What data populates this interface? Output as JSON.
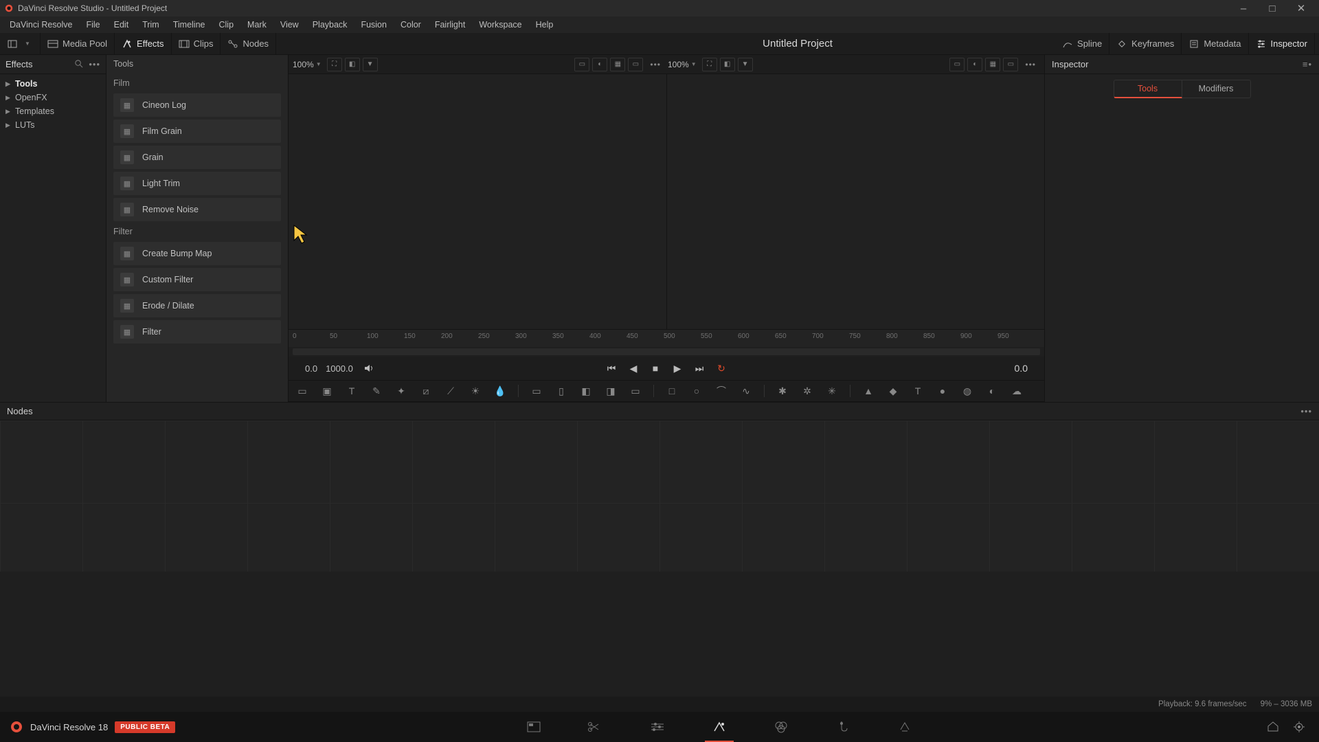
{
  "titlebar": {
    "title": "DaVinci Resolve Studio - Untitled Project"
  },
  "menubar": [
    "DaVinci Resolve",
    "File",
    "Edit",
    "Trim",
    "Timeline",
    "Clip",
    "Mark",
    "View",
    "Playback",
    "Fusion",
    "Color",
    "Fairlight",
    "Workspace",
    "Help"
  ],
  "toolbar": {
    "media_pool": "Media Pool",
    "effects": "Effects",
    "clips": "Clips",
    "nodes": "Nodes",
    "project_title": "Untitled Project",
    "spline": "Spline",
    "keyframes": "Keyframes",
    "metadata": "Metadata",
    "inspector": "Inspector"
  },
  "effects_sidebar": {
    "title": "Effects",
    "tree": [
      {
        "label": "Tools",
        "selected": true,
        "arrow": true
      },
      {
        "label": "OpenFX",
        "arrow": true
      },
      {
        "label": "Templates",
        "arrow": true
      },
      {
        "label": "LUTs",
        "arrow": true
      }
    ]
  },
  "tools_panel": {
    "header": "Tools",
    "groups": [
      {
        "name": "Film",
        "items": [
          "Cineon Log",
          "Film Grain",
          "Grain",
          "Light Trim",
          "Remove Noise"
        ]
      },
      {
        "name": "Filter",
        "items": [
          "Create Bump Map",
          "Custom Filter",
          "Erode / Dilate",
          "Filter"
        ]
      }
    ]
  },
  "viewer": {
    "zoom_left": "100%",
    "zoom_right": "100%",
    "ruler_ticks": [
      "0",
      "50",
      "100",
      "150",
      "200",
      "250",
      "300",
      "350",
      "400",
      "450",
      "500",
      "550",
      "600",
      "650",
      "700",
      "750",
      "800",
      "850",
      "900",
      "950"
    ],
    "time_start": "0.0",
    "time_end": "1000.0",
    "time_current": "0.0"
  },
  "inspector": {
    "title": "Inspector",
    "tabs": [
      "Tools",
      "Modifiers"
    ],
    "active_tab": 0
  },
  "nodes": {
    "title": "Nodes"
  },
  "infobar": {
    "playback": "Playback: 9.6 frames/sec",
    "mem": "9% – 3036 MB"
  },
  "bottombar": {
    "brand": "DaVinci Resolve 18",
    "badge": "PUBLIC BETA"
  }
}
